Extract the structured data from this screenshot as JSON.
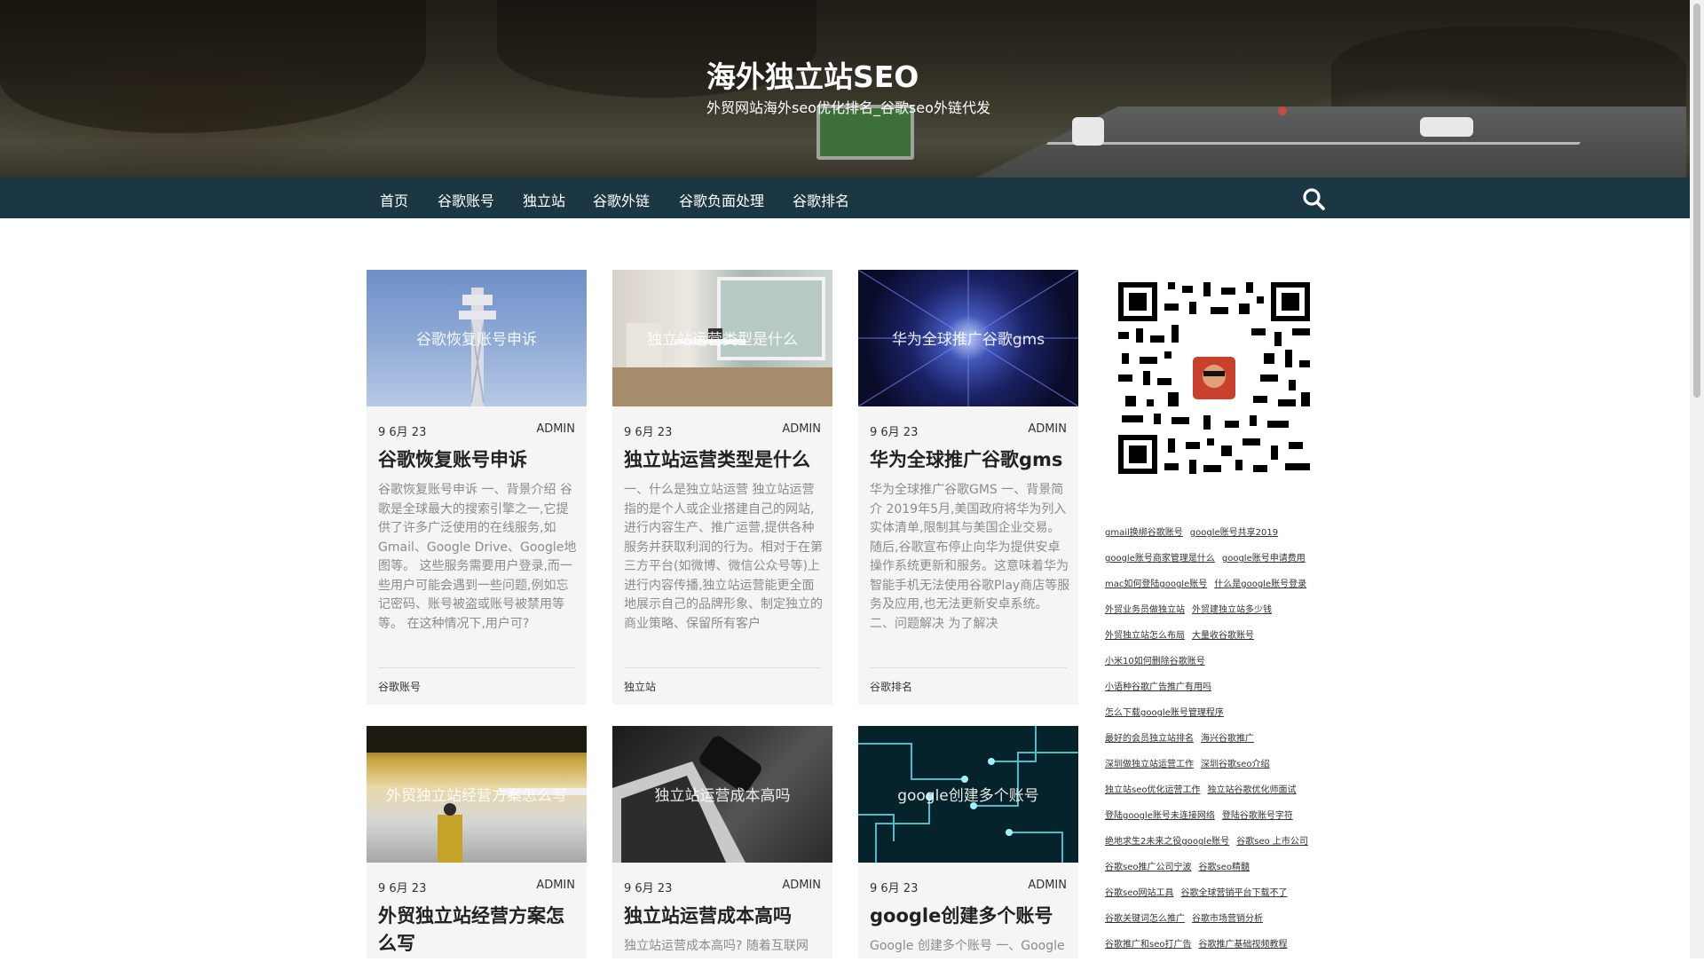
{
  "site": {
    "title": "海外独立站SEO",
    "tagline": "外贸网站海外seo优化排名_谷歌seo外链代发"
  },
  "nav": {
    "items": [
      "首页",
      "谷歌账号",
      "独立站",
      "谷歌外链",
      "谷歌负面处理",
      "谷歌排名"
    ]
  },
  "cards": [
    {
      "image_title": "谷歌恢复账号申诉",
      "date": "9 6月 23",
      "author": "ADMIN",
      "title": "谷歌恢复账号申诉",
      "excerpt": "谷歌恢复账号申诉 一、背景介绍 谷歌是全球最大的搜索引擎之一,它提供了许多广泛使用的在线服务,如Gmail、Google Drive、Google地图等。 这些服务需要用户登录,而一些用户可能会遇到一些问题,例如忘记密码、账号被盗或账号被禁用等等。 在这种情况下,用户可?",
      "category": "谷歌账号"
    },
    {
      "image_title": "独立站运营类型是什么",
      "date": "9 6月 23",
      "author": "ADMIN",
      "title": "独立站运营类型是什么",
      "excerpt": "一、什么是独立站运营 独立站运营指的是个人或企业搭建自己的网站,进行内容生产、推广运营,提供各种服务并获取利润的行为。相对于在第三方平台(如微博、微信公众号等)上进行内容传播,独立站运营能更全面地展示自己的品牌形象、制定独立的商业策略、保留所有客户",
      "category": "独立站"
    },
    {
      "image_title": "华为全球推广谷歌gms",
      "date": "9 6月 23",
      "author": "ADMIN",
      "title": "华为全球推广谷歌gms",
      "excerpt": "华为全球推广谷歌GMS 一、背景简介 2019年5月,美国政府将华为列入实体清单,限制其与美国企业交易。随后,谷歌宣布停止向华为提供安卓操作系统更新和服务。这意味着华为智能手机无法使用谷歌Play商店等服务及应用,也无法更新安卓系统。 二、问题解决 为了解决",
      "category": "谷歌排名"
    },
    {
      "image_title": "外贸独立站经营方案怎么写",
      "date": "9 6月 23",
      "author": "ADMIN",
      "title": "外贸独立站经营方案怎么写",
      "excerpt": "",
      "category": ""
    },
    {
      "image_title": "独立站运营成本高吗",
      "date": "9 6月 23",
      "author": "ADMIN",
      "title": "独立站运营成本高吗",
      "excerpt": "独立站运营成本高吗? 随着互联网",
      "category": ""
    },
    {
      "image_title": "google创建多个账号",
      "date": "9 6月 23",
      "author": "ADMIN",
      "title": "google创建多个账号",
      "excerpt": "Google 创建多个账号 一、Google",
      "category": ""
    }
  ],
  "sidebar": {
    "tag_rows": [
      [
        "gmail换绑谷歌账号",
        "google账号共享2019"
      ],
      [
        "google账号商家管理是什么",
        "google账号申请费用"
      ],
      [
        "mac如何登陆google账号",
        "什么是google账号登录"
      ],
      [
        "外贸业务员做独立站",
        "外贸建独立站多少钱"
      ],
      [
        "外贸独立站怎么布局",
        "大量收谷歌账号"
      ],
      [
        "小米10如何删除谷歌账号"
      ],
      [
        "小语种谷歌广告推广有用吗"
      ],
      [
        "怎么下载google账号管理程序"
      ],
      [
        "最好的会员独立站排名",
        "海兴谷歌推广"
      ],
      [
        "深圳做独立站运营工作",
        "深圳谷歌seo介绍"
      ],
      [
        "独立站seo优化运营工作",
        "独立站谷歌优化师面试"
      ],
      [
        "登陆google账号未连接网络",
        "登陆谷歌账号字符"
      ],
      [
        "绝地求生2未来之役google账号",
        "谷歌seo 上市公司"
      ],
      [
        "谷歌seo推广公司宁波",
        "谷歌seo精髓"
      ],
      [
        "谷歌seo网站工具",
        "谷歌全球营销平台下载不了"
      ],
      [
        "谷歌关键词怎么推广",
        "谷歌市场营销分析"
      ],
      [
        "谷歌推广和seo打广告",
        "谷歌推广基础视频教程"
      ]
    ]
  },
  "colors": {
    "navbar": "#1b3744",
    "card_bg": "#f5f5f5",
    "excerpt_text": "#8b8b8b"
  }
}
